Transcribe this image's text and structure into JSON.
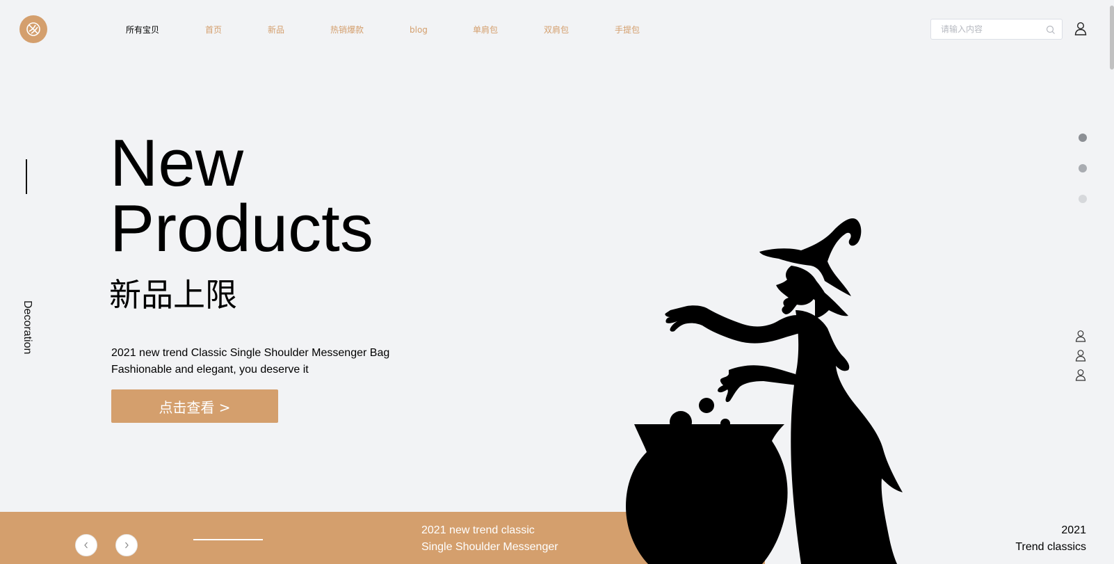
{
  "header": {
    "logo_icon": "basketball-icon",
    "nav": [
      {
        "label": "所有宝贝",
        "active": true
      },
      {
        "label": "首页",
        "active": false
      },
      {
        "label": "新品",
        "active": false
      },
      {
        "label": "热销爆款",
        "active": false
      },
      {
        "label": "blog",
        "active": false
      },
      {
        "label": "单肩包",
        "active": false
      },
      {
        "label": "双肩包",
        "active": false
      },
      {
        "label": "手提包",
        "active": false
      }
    ],
    "search": {
      "placeholder": "请输入内容",
      "value": ""
    },
    "user_icon": "user-icon"
  },
  "sidebar": {
    "decoration_label": "Decoration"
  },
  "hero": {
    "title_line1": "New",
    "title_line2": "Products",
    "subtitle": "新品上限",
    "desc_line1": "2021 new trend Classic Single Shoulder Messenger Bag",
    "desc_line2": "Fashionable and elegant, you deserve it",
    "cta_label": "点击查看 >"
  },
  "carousel": {
    "dots": [
      {
        "state": "active",
        "color": "#8c8f94"
      },
      {
        "state": "inactive",
        "color": "#a9acb1"
      },
      {
        "state": "inactive",
        "color": "#d6d8db"
      }
    ],
    "prev_icon": "chevron-left-icon",
    "next_icon": "chevron-right-icon"
  },
  "side_icons": [
    "user-icon",
    "user-icon",
    "user-icon"
  ],
  "bottom": {
    "caption_line1": "2021 new trend classic",
    "caption_line2": "Single Shoulder Messenger",
    "trend_line1": "2021",
    "trend_line2": "Trend classics"
  },
  "colors": {
    "accent": "#d49f6d",
    "background": "#f2f3f5",
    "text": "#000000"
  }
}
